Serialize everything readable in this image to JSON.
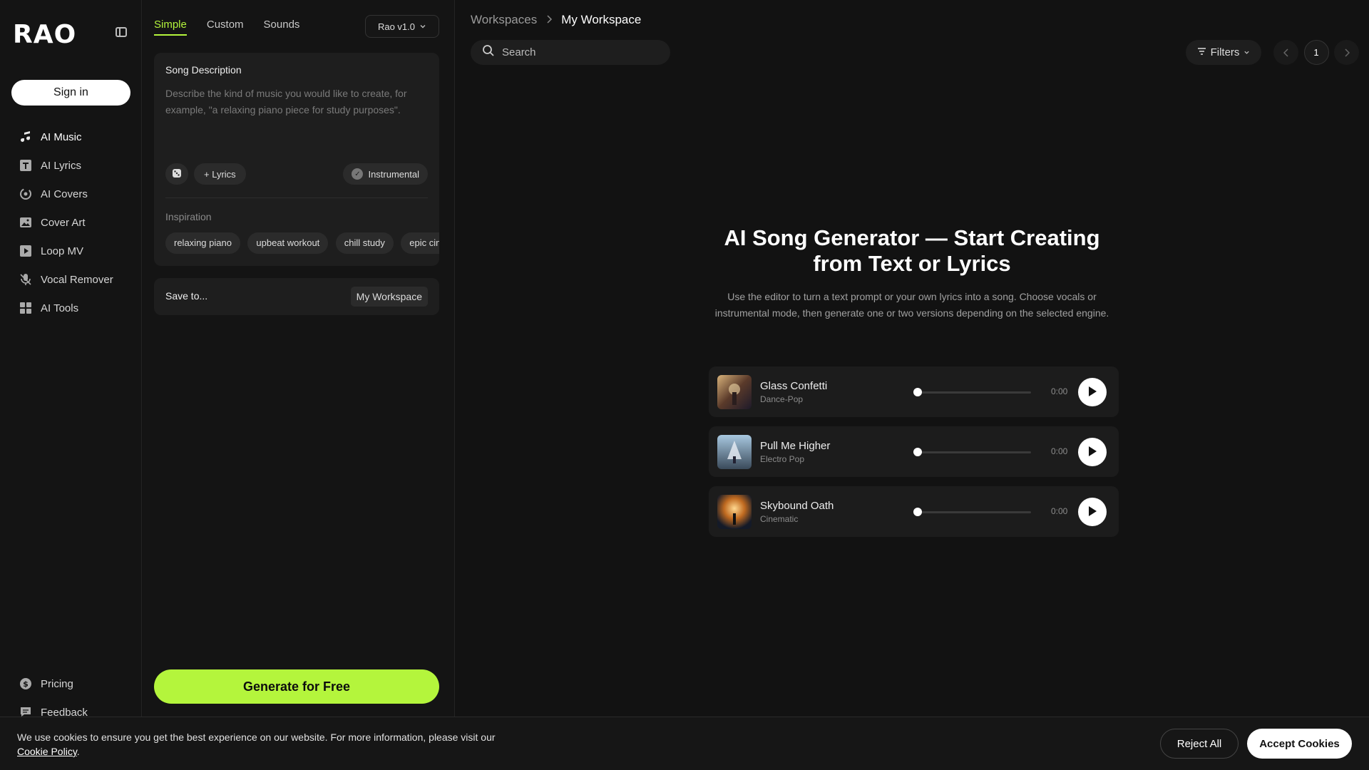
{
  "sidebar": {
    "logo": "RAO",
    "sign_in": "Sign in",
    "items": [
      {
        "label": "AI Music",
        "icon": "music-note-icon"
      },
      {
        "label": "AI Lyrics",
        "icon": "text-t-icon"
      },
      {
        "label": "AI Covers",
        "icon": "refresh-mic-icon"
      },
      {
        "label": "Cover Art",
        "icon": "image-icon"
      },
      {
        "label": "Loop MV",
        "icon": "play-square-icon"
      },
      {
        "label": "Vocal Remover",
        "icon": "mic-off-icon"
      },
      {
        "label": "AI Tools",
        "icon": "grid-icon"
      }
    ],
    "bottom_items": [
      {
        "label": "Pricing",
        "icon": "dollar-circle-icon"
      },
      {
        "label": "Feedback",
        "icon": "chat-icon"
      }
    ]
  },
  "editor": {
    "tabs": [
      "Simple",
      "Custom",
      "Sounds"
    ],
    "active_tab": "Simple",
    "version": "Rao v1.0",
    "song_description_label": "Song Description",
    "song_description_placeholder": "Describe the kind of music you would like to create, for example, \"a relaxing piano piece for study purposes\".",
    "lyrics_button": "Lyrics",
    "instrumental_button": "Instrumental",
    "inspiration_label": "Inspiration",
    "inspiration_chips": [
      "relaxing piano",
      "upbeat workout",
      "chill study",
      "epic cinematic"
    ],
    "save_to_label": "Save to...",
    "save_to_value": "My Workspace",
    "generate_button": "Generate for Free"
  },
  "main": {
    "breadcrumb": [
      "Workspaces",
      "My Workspace"
    ],
    "search_placeholder": "Search",
    "filters_label": "Filters",
    "page_number": "1",
    "hero_title": "AI Song Generator — Start Creating from Text or Lyrics",
    "hero_subtitle": "Use the editor to turn a text prompt or your own lyrics into a song. Choose vocals or instrumental mode, then generate one or two versions depending on the selected engine.",
    "tracks": [
      {
        "title": "Glass Confetti",
        "genre": "Dance-Pop",
        "time": "0:00",
        "progress": 0
      },
      {
        "title": "Pull Me Higher",
        "genre": "Electro Pop",
        "time": "0:00",
        "progress": 0
      },
      {
        "title": "Skybound Oath",
        "genre": "Cinematic",
        "time": "0:00",
        "progress": 0
      }
    ]
  },
  "cookie": {
    "text": "We use cookies to ensure you get the best experience on our website. For more information, please visit our",
    "link": "Cookie Policy",
    "reject": "Reject All",
    "accept": "Accept Cookies"
  },
  "colors": {
    "accent": "#b4f53c",
    "background": "#121212",
    "panel": "#141414",
    "card": "#1e1e1e"
  }
}
